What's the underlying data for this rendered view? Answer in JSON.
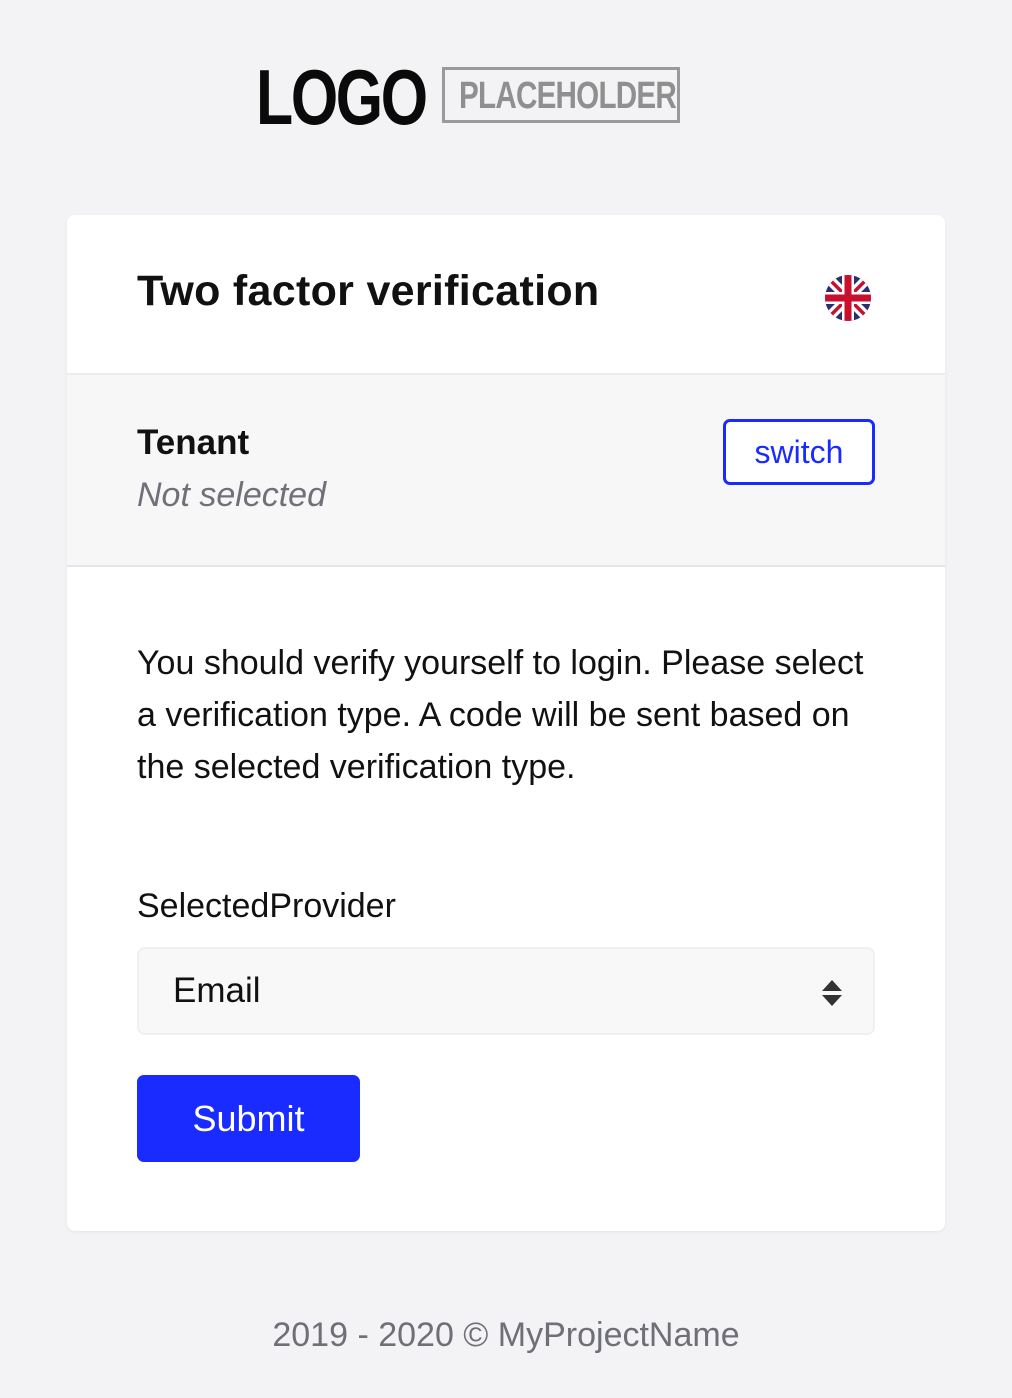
{
  "logo": {
    "main_text": "LOGO",
    "sub_text": "PLACEHOLDER"
  },
  "card": {
    "title": "Two factor verification",
    "language_icon": "uk-flag-icon"
  },
  "tenant": {
    "label": "Tenant",
    "value": "Not selected",
    "switch_label": "switch"
  },
  "form": {
    "description": "You should verify yourself to login. Please select a verification type. A code will be sent based on the selected verification type.",
    "provider_label": "SelectedProvider",
    "provider_value": "Email",
    "submit_label": "Submit"
  },
  "footer": {
    "text": "2019 - 2020 © MyProjectName"
  },
  "colors": {
    "primary": "#1a2bff",
    "background": "#f3f3f5",
    "card": "#ffffff",
    "muted_text": "#707078"
  }
}
